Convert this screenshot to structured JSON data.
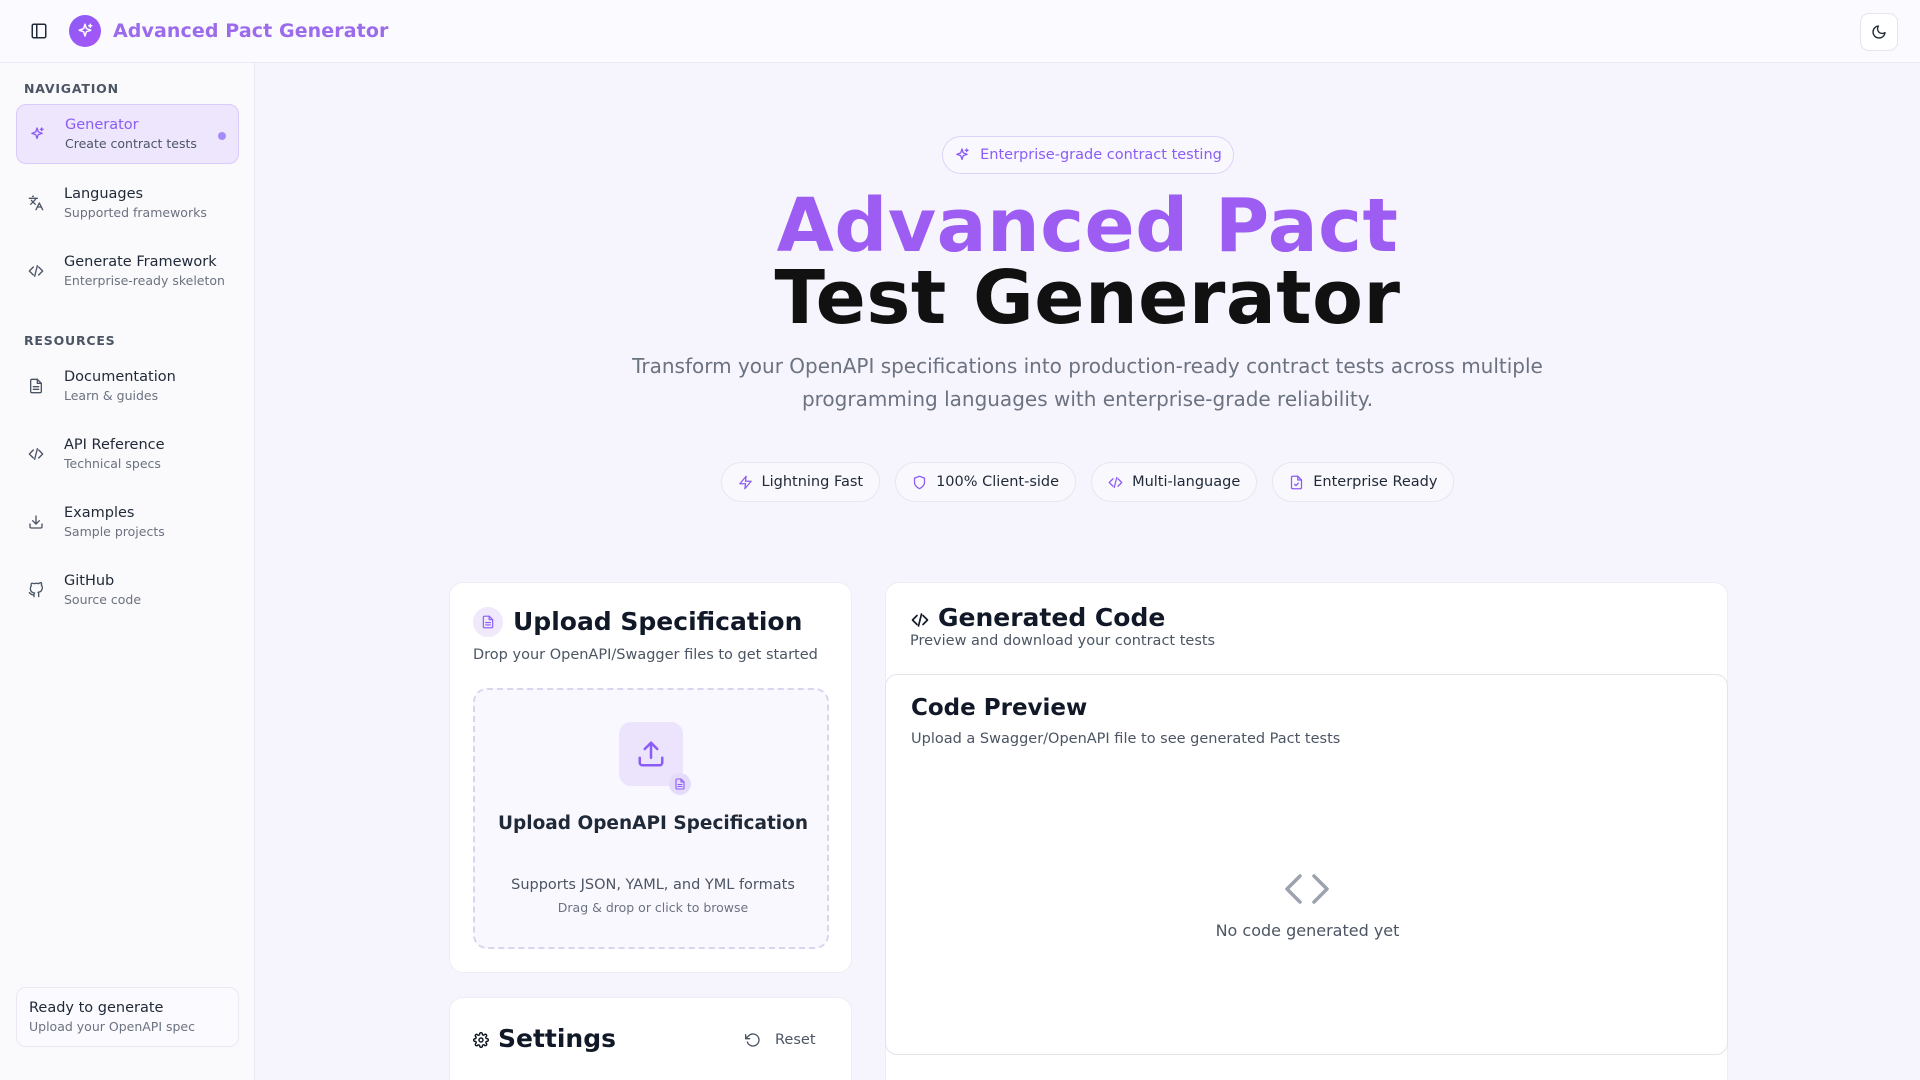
{
  "header": {
    "app_title": "Advanced Pact Generator",
    "icons": {
      "sidebar_toggle": "panel-left-icon",
      "logo": "sparkles-icon",
      "theme": "moon-icon"
    }
  },
  "sidebar": {
    "navigation_title": "NAVIGATION",
    "resources_title": "RESOURCES",
    "nav_items": [
      {
        "label": "Generator",
        "sub": "Create contract tests",
        "icon": "sparkles-icon",
        "active": true
      },
      {
        "label": "Languages",
        "sub": "Supported frameworks",
        "icon": "languages-icon"
      },
      {
        "label": "Generate Framework",
        "sub": "Enterprise-ready skeleton",
        "icon": "code-icon"
      }
    ],
    "resource_items": [
      {
        "label": "Documentation",
        "sub": "Learn & guides",
        "icon": "file-text-icon"
      },
      {
        "label": "API Reference",
        "sub": "Technical specs",
        "icon": "code-icon"
      },
      {
        "label": "Examples",
        "sub": "Sample projects",
        "icon": "download-icon"
      },
      {
        "label": "GitHub",
        "sub": "Source code",
        "icon": "github-icon"
      }
    ],
    "status": {
      "title": "Ready to generate",
      "sub": "Upload your OpenAPI spec"
    }
  },
  "hero": {
    "badge": "Enterprise-grade contract testing",
    "title_line1": "Advanced Pact",
    "title_line2": "Test Generator",
    "description": "Transform your OpenAPI specifications into production-ready contract tests across multiple programming languages with enterprise-grade reliability.",
    "chips": [
      {
        "label": "Lightning Fast",
        "icon": "zap-icon"
      },
      {
        "label": "100% Client-side",
        "icon": "shield-icon"
      },
      {
        "label": "Multi-language",
        "icon": "code-icon"
      },
      {
        "label": "Enterprise Ready",
        "icon": "file-check-icon"
      }
    ]
  },
  "upload": {
    "title": "Upload Specification",
    "subtitle": "Drop your OpenAPI/Swagger files to get started",
    "dropzone_title": "Upload OpenAPI Specification",
    "dropzone_formats": "Supports JSON, YAML, and YML formats",
    "dropzone_hint": "Drag & drop or click to browse"
  },
  "settings": {
    "title": "Settings",
    "reset_label": "Reset"
  },
  "generated": {
    "title": "Generated Code",
    "subtitle": "Preview and download your contract tests",
    "preview_title": "Code Preview",
    "preview_subtitle": "Upload a Swagger/OpenAPI file to see generated Pact tests",
    "empty_text": "No code generated yet"
  },
  "colors": {
    "accent": "#8b5cf6",
    "accent_light": "#ede6fd",
    "background": "#f6f4fd"
  }
}
